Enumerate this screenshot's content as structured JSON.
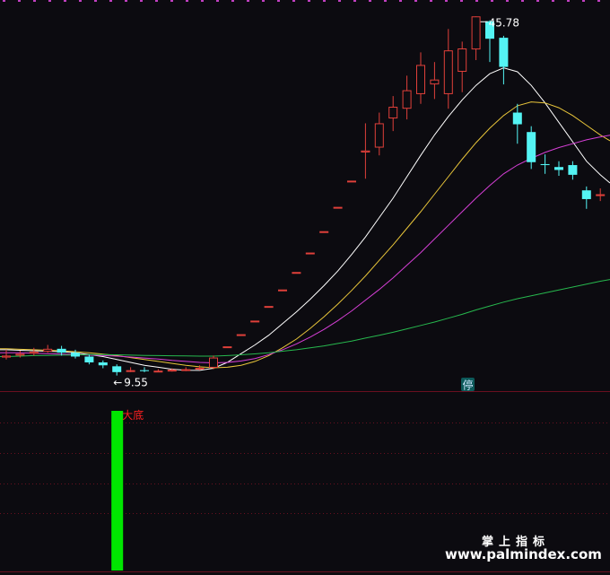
{
  "chart_data": {
    "type": "candlestick",
    "title": "",
    "price_labels": {
      "high": "45.78",
      "low": "9.55",
      "low_prefix": "←"
    },
    "badge": "停",
    "indicator_label": "大底",
    "watermark": {
      "line1": "掌上指标",
      "line2": "www.palmindex.com"
    },
    "candles": [
      [
        11.4,
        11.6,
        12.2,
        11.2
      ],
      [
        11.6,
        11.8,
        12.1,
        11.4
      ],
      [
        11.8,
        12.0,
        12.4,
        11.6
      ],
      [
        12.0,
        12.3,
        12.7,
        11.9
      ],
      [
        12.3,
        11.9,
        12.6,
        11.6
      ],
      [
        11.9,
        11.5,
        12.2,
        11.3
      ],
      [
        11.5,
        10.9,
        11.7,
        10.7
      ],
      [
        10.9,
        10.6,
        11.1,
        10.3
      ],
      [
        10.5,
        9.9,
        10.7,
        9.55
      ],
      [
        10.0,
        10.1,
        10.4,
        9.9
      ],
      [
        10.1,
        10.0,
        10.4,
        9.9
      ],
      [
        10.0,
        10.05,
        10.2,
        9.9
      ],
      [
        10.1,
        10.15,
        10.3,
        9.95
      ],
      [
        10.15,
        10.2,
        10.4,
        10.0
      ],
      [
        10.2,
        10.35,
        10.6,
        10.1
      ],
      [
        10.35,
        11.4,
        11.6,
        10.2
      ],
      [
        12.55,
        12.55,
        12.55,
        12.55
      ],
      [
        13.8,
        13.8,
        13.8,
        13.8
      ],
      [
        15.2,
        15.2,
        15.2,
        15.2
      ],
      [
        16.7,
        16.7,
        16.7,
        16.7
      ],
      [
        18.4,
        18.4,
        18.4,
        18.4
      ],
      [
        20.2,
        20.2,
        20.2,
        20.2
      ],
      [
        22.2,
        22.2,
        22.2,
        22.2
      ],
      [
        24.4,
        24.4,
        24.4,
        24.4
      ],
      [
        26.9,
        26.9,
        26.9,
        26.9
      ],
      [
        29.6,
        29.6,
        29.6,
        29.6
      ],
      [
        32.5,
        32.7,
        35.5,
        29.8
      ],
      [
        33.0,
        35.5,
        36.6,
        32.2
      ],
      [
        36.0,
        37.2,
        38.3,
        34.7
      ],
      [
        37.0,
        38.9,
        40.4,
        35.9
      ],
      [
        38.5,
        41.5,
        42.8,
        37.5
      ],
      [
        39.5,
        40.0,
        41.8,
        38.0
      ],
      [
        38.5,
        43.0,
        45.2,
        37.0
      ],
      [
        40.8,
        43.2,
        43.9,
        38.7
      ],
      [
        43.1,
        46.5,
        46.5,
        42.0
      ],
      [
        46.0,
        44.2,
        46.1,
        41.8
      ],
      [
        44.3,
        41.3,
        44.5,
        39.5
      ],
      [
        36.6,
        35.4,
        37.5,
        33.4
      ],
      [
        34.6,
        31.5,
        35.2,
        30.8
      ],
      [
        31.3,
        31.2,
        32.3,
        30.3
      ],
      [
        31.0,
        30.7,
        31.6,
        30.1
      ],
      [
        31.2,
        30.2,
        31.6,
        29.7
      ],
      [
        28.6,
        27.7,
        29.0,
        26.7
      ],
      [
        28.2,
        28.2,
        28.8,
        27.5
      ]
    ],
    "ma_series": [
      {
        "color": "#ffffff",
        "values": [
          12.2,
          12.15,
          12.1,
          12.05,
          12.0,
          11.9,
          11.7,
          11.5,
          11.2,
          10.9,
          10.6,
          10.4,
          10.2,
          10.1,
          10.08,
          10.3,
          10.9,
          11.8,
          12.7,
          13.7,
          14.9,
          16.1,
          17.4,
          18.8,
          20.3,
          22.0,
          23.8,
          25.8,
          27.8,
          30.0,
          32.2,
          34.3,
          36.2,
          37.9,
          39.4,
          40.6,
          41.2,
          40.8,
          39.4,
          37.6,
          35.6,
          33.6,
          31.6,
          30.2
        ]
      },
      {
        "color": "#e8c53a",
        "values": [
          12.3,
          12.25,
          12.2,
          12.15,
          12.1,
          12.0,
          11.9,
          11.75,
          11.6,
          11.4,
          11.2,
          11.0,
          10.8,
          10.6,
          10.45,
          10.35,
          10.4,
          10.6,
          11.0,
          11.6,
          12.4,
          13.3,
          14.4,
          15.6,
          16.9,
          18.3,
          19.8,
          21.4,
          23.0,
          24.7,
          26.4,
          28.2,
          30.0,
          31.8,
          33.5,
          35.0,
          36.3,
          37.3,
          37.7,
          37.6,
          37.1,
          36.3,
          35.3,
          34.3
        ]
      },
      {
        "color": "#d63fd6",
        "values": [
          11.9,
          11.9,
          11.85,
          11.8,
          11.75,
          11.7,
          11.65,
          11.6,
          11.55,
          11.45,
          11.35,
          11.25,
          11.1,
          11.0,
          10.9,
          10.85,
          10.9,
          11.05,
          11.3,
          11.7,
          12.2,
          12.8,
          13.5,
          14.3,
          15.2,
          16.2,
          17.3,
          18.4,
          19.6,
          20.9,
          22.2,
          23.6,
          25.0,
          26.4,
          27.8,
          29.1,
          30.3,
          31.2,
          31.9,
          32.5,
          33.0,
          33.4,
          33.8,
          34.1
        ]
      },
      {
        "color": "#27b84e",
        "values": [
          11.5,
          11.55,
          11.6,
          11.62,
          11.65,
          11.67,
          11.7,
          11.7,
          11.68,
          11.65,
          11.62,
          11.6,
          11.58,
          11.56,
          11.55,
          11.55,
          11.6,
          11.68,
          11.78,
          11.9,
          12.05,
          12.2,
          12.4,
          12.6,
          12.85,
          13.1,
          13.4,
          13.7,
          14.0,
          14.35,
          14.7,
          15.05,
          15.45,
          15.85,
          16.3,
          16.7,
          17.1,
          17.45,
          17.75,
          18.05,
          18.35,
          18.65,
          18.95,
          19.25
        ]
      }
    ],
    "indicator_bar": {
      "candle_index": 8,
      "value": 1.0
    },
    "colors": {
      "up": "#e0403a",
      "down": "#54f4f4",
      "background": "#0c0b10",
      "grid": "#6a1020",
      "indicator": "#00e600",
      "label": "#ffffff",
      "indicator_label": "#ff2020",
      "badge_bg": "#0d5a5a",
      "badge_text": "#cfe8ff"
    },
    "price_range": [
      8.5,
      48.0
    ]
  }
}
